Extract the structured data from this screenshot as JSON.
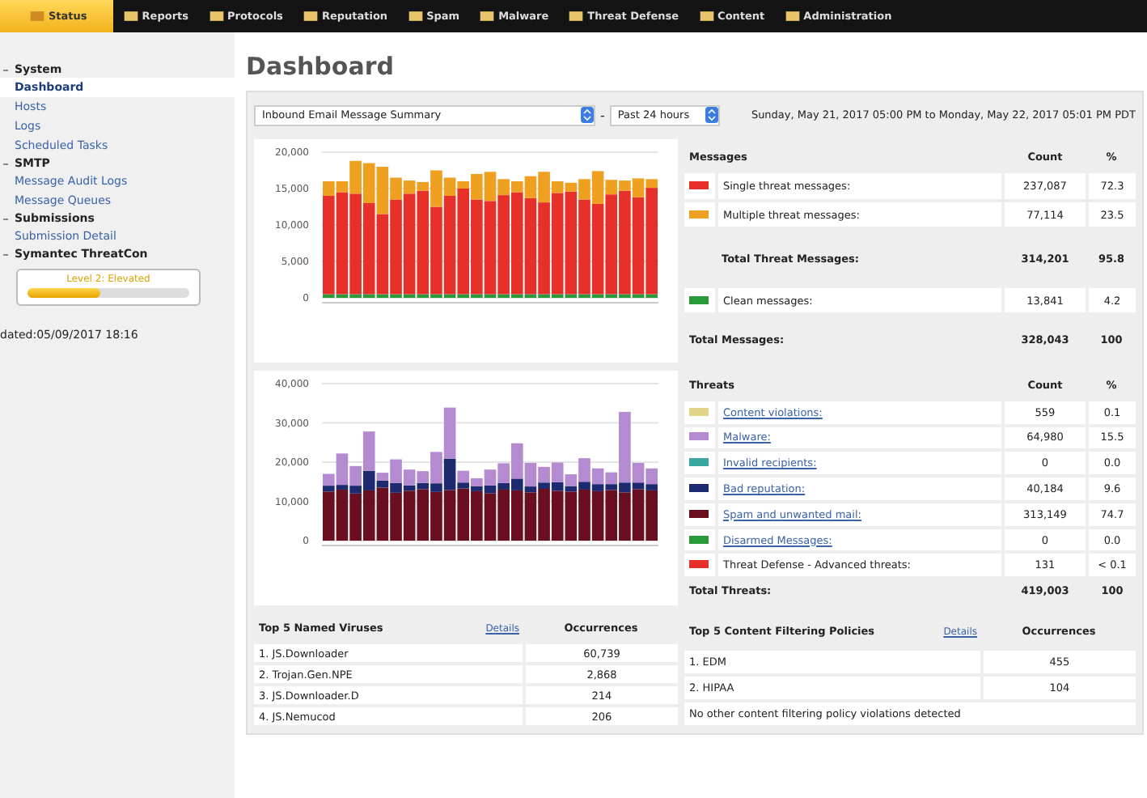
{
  "nav_tabs": [
    {
      "label": "Status",
      "selected": true
    },
    {
      "label": "Reports",
      "selected": false
    },
    {
      "label": "Protocols",
      "selected": false
    },
    {
      "label": "Reputation",
      "selected": false
    },
    {
      "label": "Spam",
      "selected": false
    },
    {
      "label": "Malware",
      "selected": false
    },
    {
      "label": "Threat Defense",
      "selected": false
    },
    {
      "label": "Content",
      "selected": false
    },
    {
      "label": "Administration",
      "selected": false
    }
  ],
  "sidebar": {
    "sections": [
      {
        "label": "System",
        "expanded": true,
        "children": [
          {
            "label": "Dashboard",
            "selected": true
          },
          {
            "label": "Hosts",
            "selected": false
          },
          {
            "label": "Logs",
            "selected": false
          },
          {
            "label": "Scheduled Tasks",
            "selected": false
          }
        ]
      },
      {
        "label": "SMTP",
        "expanded": true,
        "children": [
          {
            "label": "Message Audit Logs",
            "selected": false
          },
          {
            "label": "Message Queues",
            "selected": false
          }
        ]
      },
      {
        "label": "Submissions",
        "expanded": true,
        "children": [
          {
            "label": "Submission Detail",
            "selected": false
          }
        ]
      },
      {
        "label": "Symantec ThreatCon",
        "expanded": true
      }
    ],
    "threatcon": {
      "label": "Level 2: Elevated",
      "level": 0.45
    },
    "updated": "dated:05/09/2017 18:16"
  },
  "page_title": "Dashboard",
  "filter": {
    "report": "Inbound Email Message Summary",
    "separator": "-",
    "period": "Past 24 hours",
    "range": "Sunday, May 21, 2017 05:00 PM to Monday, May 22, 2017 05:01 PM PDT"
  },
  "messages_chart": {
    "chart_data": {
      "type": "bar",
      "stacked": true,
      "grid": true,
      "ylim": [
        0,
        20000
      ],
      "yticks": [
        {
          "value": 0,
          "label": "0"
        },
        {
          "value": 5000,
          "label": "5,000"
        },
        {
          "value": 10000,
          "label": "10,000"
        },
        {
          "value": 15000,
          "label": "15,000"
        },
        {
          "value": 20000,
          "label": "20,000"
        }
      ],
      "series": [
        {
          "color": "#2a9a3a",
          "values": [
            500,
            500,
            500,
            500,
            500,
            500,
            500,
            500,
            500,
            500,
            500,
            500,
            500,
            500,
            500,
            500,
            500,
            500,
            500,
            500,
            500,
            500,
            500,
            500,
            500
          ]
        },
        {
          "color": "#e8302a",
          "values": [
            13500,
            14000,
            13800,
            12500,
            11000,
            13000,
            13800,
            14200,
            12000,
            13500,
            14500,
            13000,
            12800,
            13600,
            14000,
            13200,
            12600,
            13900,
            14100,
            13000,
            12400,
            13700,
            14200,
            13300,
            14600
          ]
        },
        {
          "color": "#f0a020",
          "values": [
            2000,
            1500,
            4500,
            5500,
            6500,
            3000,
            1800,
            1200,
            5000,
            2500,
            1000,
            3500,
            4000,
            2200,
            1500,
            3000,
            4200,
            1600,
            1200,
            2800,
            4500,
            2000,
            1400,
            2600,
            1200
          ]
        }
      ]
    }
  },
  "messages_table": {
    "columns": [
      "Messages",
      "Count",
      "%"
    ],
    "rows": [
      {
        "kind": "item",
        "color": "#e8302a",
        "label": "Single threat messages:",
        "count": "237,087",
        "percent": "72.3"
      },
      {
        "kind": "item",
        "color": "#f0a020",
        "label": "Multiple threat messages:",
        "count": "77,114",
        "percent": "23.5"
      },
      {
        "kind": "subtotal",
        "label": "Total Threat Messages:",
        "count": "314,201",
        "percent": "95.8"
      },
      {
        "kind": "item",
        "color": "#2a9a3a",
        "label": "Clean messages:",
        "count": "13,841",
        "percent": "4.2"
      },
      {
        "kind": "total",
        "label": "Total Messages:",
        "count": "328,043",
        "percent": "100"
      }
    ]
  },
  "threats_chart": {
    "chart_data": {
      "type": "bar",
      "stacked": true,
      "grid": true,
      "ylim": [
        0,
        40000
      ],
      "yticks": [
        {
          "value": 0,
          "label": "0"
        },
        {
          "value": 10000,
          "label": "10,000"
        },
        {
          "value": 20000,
          "label": "20,000"
        },
        {
          "value": 30000,
          "label": "30,000"
        },
        {
          "value": 40000,
          "label": "40,000"
        }
      ],
      "series": [
        {
          "color": "#6a0f1f",
          "values": [
            12500,
            13000,
            12000,
            12800,
            13500,
            12200,
            12700,
            13100,
            12400,
            12900,
            13300,
            12600,
            12100,
            13000,
            12800,
            12300,
            13200,
            12700,
            12500,
            13000,
            12600,
            12900,
            12300,
            13100,
            12800
          ]
        },
        {
          "color": "#1e2a70",
          "values": [
            1500,
            1200,
            2000,
            5000,
            1800,
            2500,
            1400,
            1600,
            2200,
            8000,
            1500,
            1300,
            2000,
            1700,
            3000,
            1500,
            1600,
            2200,
            1400,
            2000,
            1800,
            1500,
            2500,
            1700,
            1600
          ]
        },
        {
          "color": "#b48ad0",
          "values": [
            3000,
            8000,
            5000,
            10000,
            2000,
            6000,
            4000,
            3000,
            8000,
            13000,
            3000,
            2000,
            4000,
            5000,
            9000,
            6000,
            4000,
            5000,
            3000,
            6000,
            4000,
            3000,
            18000,
            5000,
            4000
          ]
        }
      ]
    }
  },
  "threats_table": {
    "columns": [
      "Threats",
      "Count",
      "%"
    ],
    "rows": [
      {
        "kind": "item",
        "color": "#e0d48a",
        "label": "Content violations:",
        "link": true,
        "count": "559",
        "percent": "0.1"
      },
      {
        "kind": "item",
        "color": "#b48ad0",
        "label": "Malware:",
        "link": true,
        "count": "64,980",
        "percent": "15.5"
      },
      {
        "kind": "item",
        "color": "#3aa8a0",
        "label": "Invalid recipients:",
        "link": true,
        "count": "0",
        "percent": "0.0"
      },
      {
        "kind": "item",
        "color": "#1e2a70",
        "label": "Bad reputation:",
        "link": true,
        "count": "40,184",
        "percent": "9.6"
      },
      {
        "kind": "item",
        "color": "#6a0f1f",
        "label": "Spam and unwanted mail:",
        "link": true,
        "count": "313,149",
        "percent": "74.7"
      },
      {
        "kind": "item",
        "color": "#2a9a3a",
        "label": "Disarmed Messages:",
        "link": true,
        "count": "0",
        "percent": "0.0"
      },
      {
        "kind": "item",
        "color": "#e8302a",
        "label": "Threat Defense - Advanced threats:",
        "link": false,
        "count": "131",
        "percent": "< 0.1"
      },
      {
        "kind": "total",
        "label": "Total Threats:",
        "count": "419,003",
        "percent": "100"
      }
    ]
  },
  "viruses_table": {
    "title": "Top 5 Named Viruses",
    "details": "Details",
    "column": "Occurrences",
    "rows": [
      {
        "name": "1. JS.Downloader",
        "count": "60,739"
      },
      {
        "name": "2. Trojan.Gen.NPE",
        "count": "2,868"
      },
      {
        "name": "3. JS.Downloader.D",
        "count": "214"
      },
      {
        "name": "4. JS.Nemucod",
        "count": "206"
      }
    ]
  },
  "policies_table": {
    "title": "Top 5 Content Filtering Policies",
    "details": "Details",
    "column": "Occurrences",
    "rows": [
      {
        "name": "1. EDM",
        "count": "455"
      },
      {
        "name": "2. HIPAA",
        "count": "104"
      }
    ],
    "note": "No other content filtering policy violations detected"
  }
}
